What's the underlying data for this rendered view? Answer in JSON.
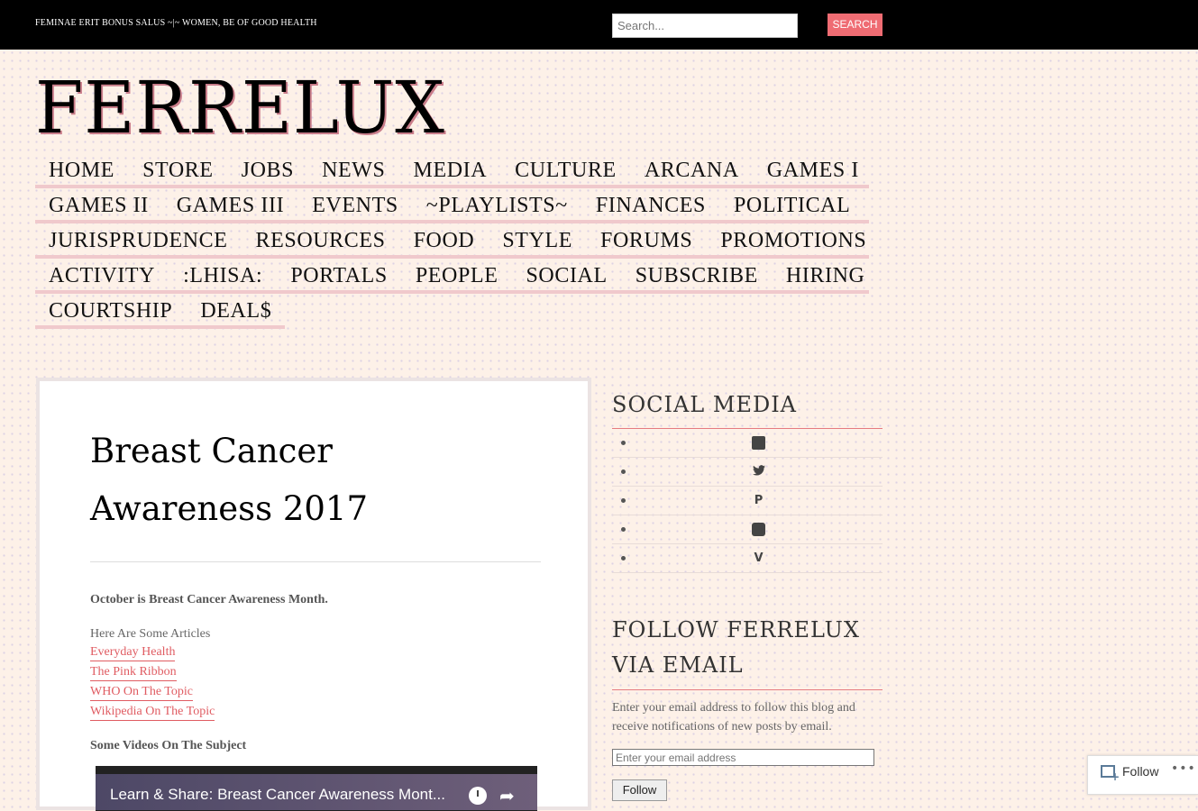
{
  "topbar": {
    "tagline": "FEMINAE ERIT BONUS SALUS ~|~ WOMEN, BE OF GOOD HEALTH",
    "search_placeholder": "Search...",
    "search_button": "SEARCH"
  },
  "site": {
    "title": "FERRELUX"
  },
  "nav": {
    "rows": [
      [
        "HOME",
        "STORE",
        "JOBS",
        "NEWS",
        "MEDIA",
        "CULTURE",
        "ARCANA",
        "GAMES I"
      ],
      [
        "GAMES II",
        "GAMES III",
        "EVENTS",
        "~PLAYLISTS~",
        "FINANCES",
        "POLITICAL"
      ],
      [
        "JURISPRUDENCE",
        "RESOURCES",
        "FOOD",
        "STYLE",
        "FORUMS",
        "PROMOTIONS"
      ],
      [
        "ACTIVITY",
        ":LHISA:",
        "PORTALS",
        "PEOPLE",
        "SOCIAL",
        "SUBSCRIBE",
        "HIRING"
      ],
      [
        "COURTSHIP",
        "DEAL$"
      ]
    ]
  },
  "post": {
    "title_line1": "Breast Cancer",
    "title_line2": "Awareness 2017",
    "intro_bold": "October is Breast Cancer Awareness Month.",
    "articles_heading": "Here Are Some Articles",
    "links": [
      "Everyday Health",
      "The Pink Ribbon",
      "WHO On The Topic",
      "Wikipedia On The Topic"
    ],
    "videos_heading": "Some Videos On The Subject",
    "video_title": "Learn & Share: Breast Cancer Awareness Mont..."
  },
  "sidebar": {
    "social_title": "SOCIAL MEDIA",
    "social_icons": [
      {
        "name": "facebook-icon",
        "glyph": "f"
      },
      {
        "name": "twitter-icon",
        "glyph": "🐦"
      },
      {
        "name": "pinterest-icon",
        "glyph": "P"
      },
      {
        "name": "youtube-icon",
        "glyph": "▶"
      },
      {
        "name": "vimeo-icon",
        "glyph": "V"
      }
    ],
    "follow_title_line1": "FOLLOW FERRELUX",
    "follow_title_line2": "VIA EMAIL",
    "follow_text": "Enter your email address to follow this blog and receive notifications of new posts by email.",
    "email_placeholder": "Enter your email address",
    "follow_button": "Follow"
  },
  "follow_bubble": {
    "label": "Follow",
    "more": "•••"
  },
  "colors": {
    "accent": "#ef6c73",
    "link": "#e05c62",
    "nav_underline": "#f0c9cc",
    "topbar": "#000000",
    "page_bg": "#fdf1e8"
  }
}
